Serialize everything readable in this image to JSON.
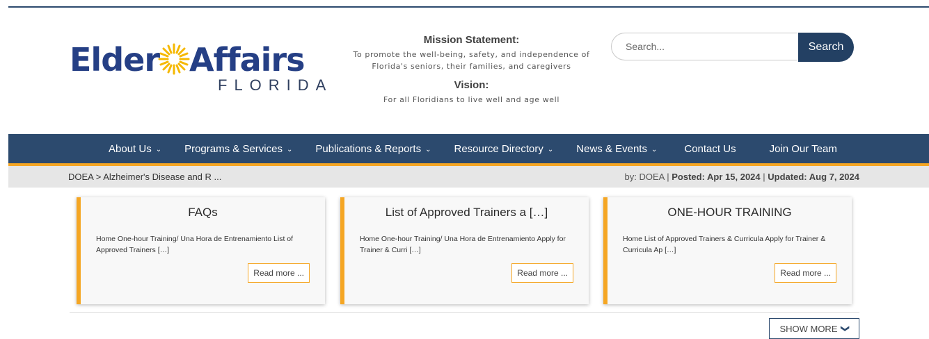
{
  "logo": {
    "word1": "Elder",
    "word2": "Affairs",
    "sub": "FLORIDA",
    "colors": {
      "primary": "#253f85",
      "sun": "#f5b800"
    }
  },
  "mission": {
    "title": "Mission Statement:",
    "text": "To promote the well-being, safety, and independence of Florida's seniors, their families, and caregivers",
    "vision_title": "Vision:",
    "vision_text": "For all Floridians to live well and age well"
  },
  "search": {
    "placeholder": "Search...",
    "button": "Search"
  },
  "nav": {
    "items": [
      {
        "label": "About Us",
        "dropdown": true
      },
      {
        "label": "Programs & Services",
        "dropdown": true
      },
      {
        "label": "Publications & Reports",
        "dropdown": true
      },
      {
        "label": "Resource Directory",
        "dropdown": true
      },
      {
        "label": "News & Events",
        "dropdown": true
      },
      {
        "label": "Contact Us",
        "dropdown": false
      },
      {
        "label": "Join Our Team",
        "dropdown": false
      }
    ]
  },
  "breadcrumb": {
    "home": "DOEA",
    "sep": ">",
    "current": "Alzheimer's Disease and R ..."
  },
  "meta": {
    "by": "by: DOEA",
    "sep": "|",
    "posted": "Posted: Apr 15, 2024",
    "updated": "Updated: Aug 7, 2024"
  },
  "cards": [
    {
      "title": "FAQs",
      "text": "Home One-hour Training/ Una Hora de Entrenamiento List of Approved Trainers […]",
      "button": "Read more ..."
    },
    {
      "title": "List of Approved Trainers a […]",
      "text": "Home One-hour Training/ Una Hora de Entrenamiento Apply for Trainer & Curri […]",
      "button": "Read more ..."
    },
    {
      "title": "ONE-HOUR TRAINING",
      "text": "Home List of Approved Trainers & Curricula Apply for Trainer & Curricula Ap […]",
      "button": "Read more ..."
    }
  ],
  "show_more": "SHOW MORE",
  "colors": {
    "nav_bg": "#2c4a6e",
    "accent": "#f5a623",
    "search_btn": "#234063"
  }
}
